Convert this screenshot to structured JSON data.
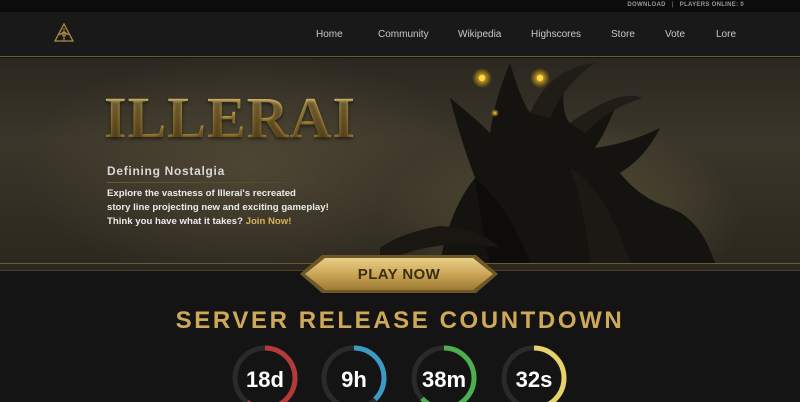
{
  "topbar": {
    "download": "DOWNLOAD",
    "separator": "|",
    "players_online": "PLAYERS ONLINE: 0"
  },
  "nav": {
    "logo_icon": "illerai-emblem-icon",
    "links": [
      "Home",
      "Community",
      "Wikipedia",
      "Highscores",
      "Store",
      "Vote",
      "Lore"
    ]
  },
  "hero": {
    "brand": "ILLERAI",
    "tagline": "Defining Nostalgia",
    "desc_line1": "Explore the vastness of Illerai's recreated",
    "desc_line2": "story line projecting new and exciting gameplay!",
    "desc_line3_prefix": "Think you have what it takes? ",
    "join_link": "Join Now!"
  },
  "play_button": {
    "label": "PLAY NOW"
  },
  "countdown": {
    "title": "SERVER RELEASE COUNTDOWN",
    "timers": [
      {
        "label": "18d",
        "color": "#b23a3a",
        "progress": 0.6
      },
      {
        "label": "9h",
        "color": "#3b9bc4",
        "progress": 0.375
      },
      {
        "label": "38m",
        "color": "#4caf50",
        "progress": 0.63
      },
      {
        "label": "32s",
        "color": "#e8d36a",
        "progress": 0.53
      }
    ]
  },
  "colors": {
    "gold": "#cfa957",
    "nav_bg": "#191919",
    "page_bg": "#141414"
  }
}
